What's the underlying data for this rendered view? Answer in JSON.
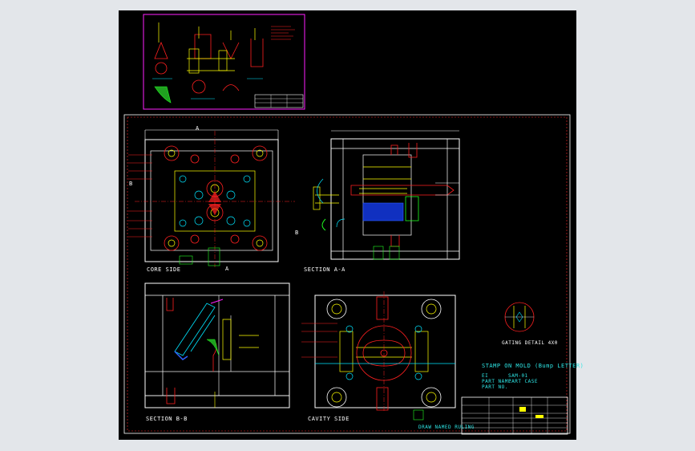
{
  "views": {
    "core_side": "CORE SIDE",
    "section_aa": "SECTION A-A",
    "section_bb": "SECTION B-B",
    "cavity_side": "CAVITY SIDE",
    "gating_detail": "GATING DETAIL 4X0"
  },
  "notes": {
    "stamp_line": "STAMP ON MOLD (Bump LETTER)",
    "row1_a": "EI",
    "row1_b": "SAM-01",
    "row2_a": "PART NAME",
    "row2_b": "PART CASE",
    "row3_a": "PART NO.",
    "footer": "DRAW NAMED RULING"
  },
  "section_marks": {
    "a_top": "A",
    "a_bottom": "A",
    "b_left": "B",
    "b_right": "B"
  },
  "colors": {
    "background": "#000000",
    "sheet_border": "#ffffff",
    "frame": "#ff2a2a",
    "geometry_white": "#ffffff",
    "geometry_yellow": "#ffff00",
    "geometry_red": "#ff2020",
    "geometry_cyan": "#00e5ff",
    "geometry_green": "#20ff20",
    "geometry_blue": "#3060ff",
    "geometry_magenta": "#ff20ff",
    "text_cyan": "#2ee6e6"
  }
}
